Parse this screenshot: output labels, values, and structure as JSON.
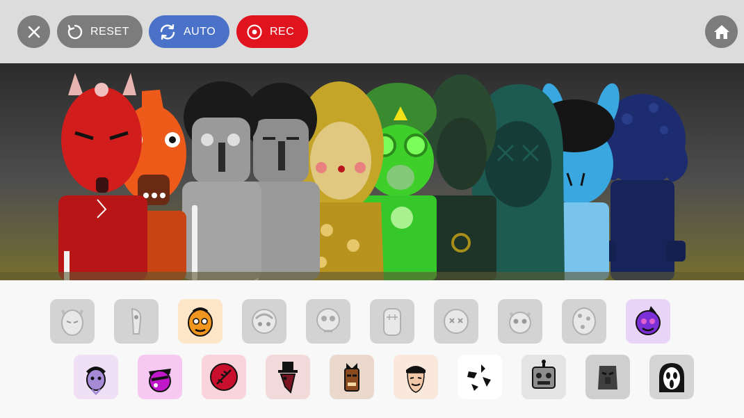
{
  "toolbar": {
    "close_icon": "close-icon",
    "reset_label": "RESET",
    "auto_label": "AUTO",
    "rec_label": "REC",
    "home_icon": "home-icon",
    "colors": {
      "bar": "#dcdcdc",
      "neutral": "#7c7c7c",
      "auto": "#4a72c8",
      "rec": "#e0141e"
    }
  },
  "stage": {
    "characters": [
      {
        "name": "red-demon",
        "state": "active",
        "color": "#d21d1d"
      },
      {
        "name": "orange-horse",
        "state": "active",
        "color": "#ee5a1a"
      },
      {
        "name": "gray-man-1",
        "state": "active",
        "color": "#9a9a9a"
      },
      {
        "name": "gray-man-2",
        "state": "active",
        "color": "#9a9a9a"
      },
      {
        "name": "yellow-doll",
        "state": "active",
        "color": "#c4a528"
      },
      {
        "name": "green-gasmask-soldier",
        "state": "active",
        "color": "#3fcf2a"
      },
      {
        "name": "dark-green-figure",
        "state": "active",
        "color": "#2b4a32"
      },
      {
        "name": "teal-hooded-figure",
        "state": "active",
        "color": "#1d5a52"
      },
      {
        "name": "blue-rabbit",
        "state": "active",
        "color": "#3aa8e0"
      },
      {
        "name": "navy-octopus",
        "state": "active",
        "color": "#1c2c6e"
      }
    ]
  },
  "tray": {
    "row1": [
      {
        "icon": "devil-mask-icon",
        "state": "used"
      },
      {
        "icon": "horse-mask-icon",
        "state": "used"
      },
      {
        "icon": "orange-face-icon",
        "state": "available",
        "bg": "#fde6c8",
        "fg": "#f0951e"
      },
      {
        "icon": "brain-head-icon",
        "state": "used"
      },
      {
        "icon": "skull-flower-icon",
        "state": "used"
      },
      {
        "icon": "stitched-face-icon",
        "state": "used"
      },
      {
        "icon": "x-eyes-icon",
        "state": "used"
      },
      {
        "icon": "cat-skull-icon",
        "state": "used"
      },
      {
        "icon": "spotted-head-icon",
        "state": "used"
      },
      {
        "icon": "purple-jester-icon",
        "state": "available",
        "bg": "#e8d4f6",
        "fg": "#7b2fd6"
      }
    ],
    "row2": [
      {
        "icon": "purple-vampire-icon",
        "state": "available",
        "bg": "#efe0f6",
        "fg": "#a58ad6"
      },
      {
        "icon": "magenta-mask-icon",
        "state": "available",
        "bg": "#f6c8f2",
        "fg": "#c018c8"
      },
      {
        "icon": "red-leaf-icon",
        "state": "available",
        "bg": "#fad4dc",
        "fg": "#c8102e"
      },
      {
        "icon": "plague-hat-icon",
        "state": "available",
        "bg": "#f3dada",
        "fg": "#7a1420"
      },
      {
        "icon": "tiki-icon",
        "state": "available",
        "bg": "#ead8cc",
        "fg": "#8a4a20"
      },
      {
        "icon": "anonymous-mask-icon",
        "state": "available",
        "bg": "#fbe8dc",
        "fg": "#f2c8a8"
      },
      {
        "icon": "splatter-icon",
        "state": "available",
        "bg": "#ffffff",
        "fg": "#111111"
      },
      {
        "icon": "robot-head-icon",
        "state": "available",
        "bg": "#e4e4e4",
        "fg": "#8e8e8e"
      },
      {
        "icon": "stone-head-icon",
        "state": "available",
        "bg": "#cfcfcf",
        "fg": "#404040"
      },
      {
        "icon": "ghostface-icon",
        "state": "available",
        "bg": "#d4d4d4",
        "fg": "#141414"
      }
    ]
  }
}
